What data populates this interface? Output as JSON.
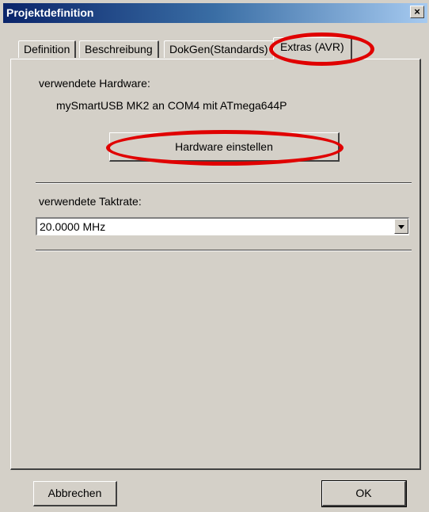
{
  "window": {
    "title": "Projektdefinition",
    "close_glyph": "×"
  },
  "tabs": [
    {
      "label": "Definition"
    },
    {
      "label": "Beschreibung"
    },
    {
      "label": "DokGen(Standards)"
    },
    {
      "label": "Extras (AVR)",
      "active": true
    }
  ],
  "extras": {
    "hardware_label": "verwendete Hardware:",
    "hardware_value": "mySmartUSB MK2 an COM4 mit ATmega644P",
    "hardware_button": "Hardware einstellen",
    "clock_label": "verwendete Taktrate:",
    "clock_value": "20.0000 MHz"
  },
  "footer": {
    "cancel_label": "Abbrechen",
    "ok_label": "OK"
  },
  "colors": {
    "highlight": "#e00000",
    "face": "#d4d0c8",
    "title_start": "#0a246a"
  }
}
